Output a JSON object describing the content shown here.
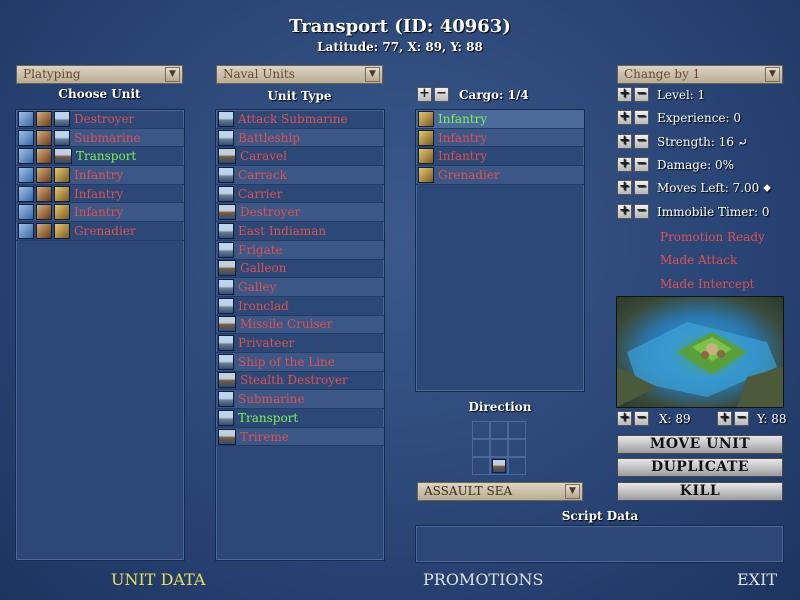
{
  "window": {
    "title": "Transport (ID: 40963)",
    "subtitle": "Latitude: 77, X: 89, Y: 88"
  },
  "left": {
    "dropdown": "Platyping",
    "header": "Choose Unit",
    "units": [
      {
        "label": "Destroyer",
        "color": "red"
      },
      {
        "label": "Submarine",
        "color": "red"
      },
      {
        "label": "Transport",
        "color": "green"
      },
      {
        "label": "Infantry",
        "color": "red"
      },
      {
        "label": "Infantry",
        "color": "red"
      },
      {
        "label": "Infantry",
        "color": "red"
      },
      {
        "label": "Grenadier",
        "color": "red"
      }
    ]
  },
  "middle": {
    "dropdown": "Naval Units",
    "header": "Unit Type",
    "types": [
      "Attack Submarine",
      "Battleship",
      "Caravel",
      "Carrack",
      "Carrier",
      "Destroyer",
      "East Indiaman",
      "Frigate",
      "Galleon",
      "Galley",
      "Ironclad",
      "Missile Cruiser",
      "Privateer",
      "Ship of the Line",
      "Stealth Destroyer",
      "Submarine",
      "Transport",
      "Trireme"
    ],
    "selected_type": "Transport"
  },
  "cargo": {
    "label": "Cargo: 1/4",
    "items": [
      {
        "label": "Infantry",
        "color": "green"
      },
      {
        "label": "Infantry",
        "color": "red"
      },
      {
        "label": "Infantry",
        "color": "red"
      },
      {
        "label": "Grenadier",
        "color": "red"
      }
    ]
  },
  "direction": {
    "header": "Direction",
    "dropdown": "ASSAULT SEA"
  },
  "script": {
    "header": "Script Data",
    "value": ""
  },
  "right": {
    "dropdown": "Change by 1",
    "stats": {
      "level": "Level: 1",
      "experience": "Experience: 0",
      "strength": "Strength: 16",
      "damage": "Damage: 0%",
      "moves": "Moves Left: 7.00",
      "immobile": "Immobile Timer: 0"
    },
    "flags": [
      "Promotion Ready",
      "Made Attack",
      "Made Intercept"
    ],
    "coord_x": "X: 89",
    "coord_y": "Y: 88",
    "buttons": {
      "move": "MOVE UNIT",
      "duplicate": "DUPLICATE",
      "kill": "KILL"
    }
  },
  "footer": {
    "unit_data": "UNIT DATA",
    "promotions": "PROMOTIONS",
    "exit": "EXIT"
  },
  "colors": {
    "red_text": "#e05050",
    "green_text": "#7cf058",
    "active_tab": "#e8e05a"
  }
}
